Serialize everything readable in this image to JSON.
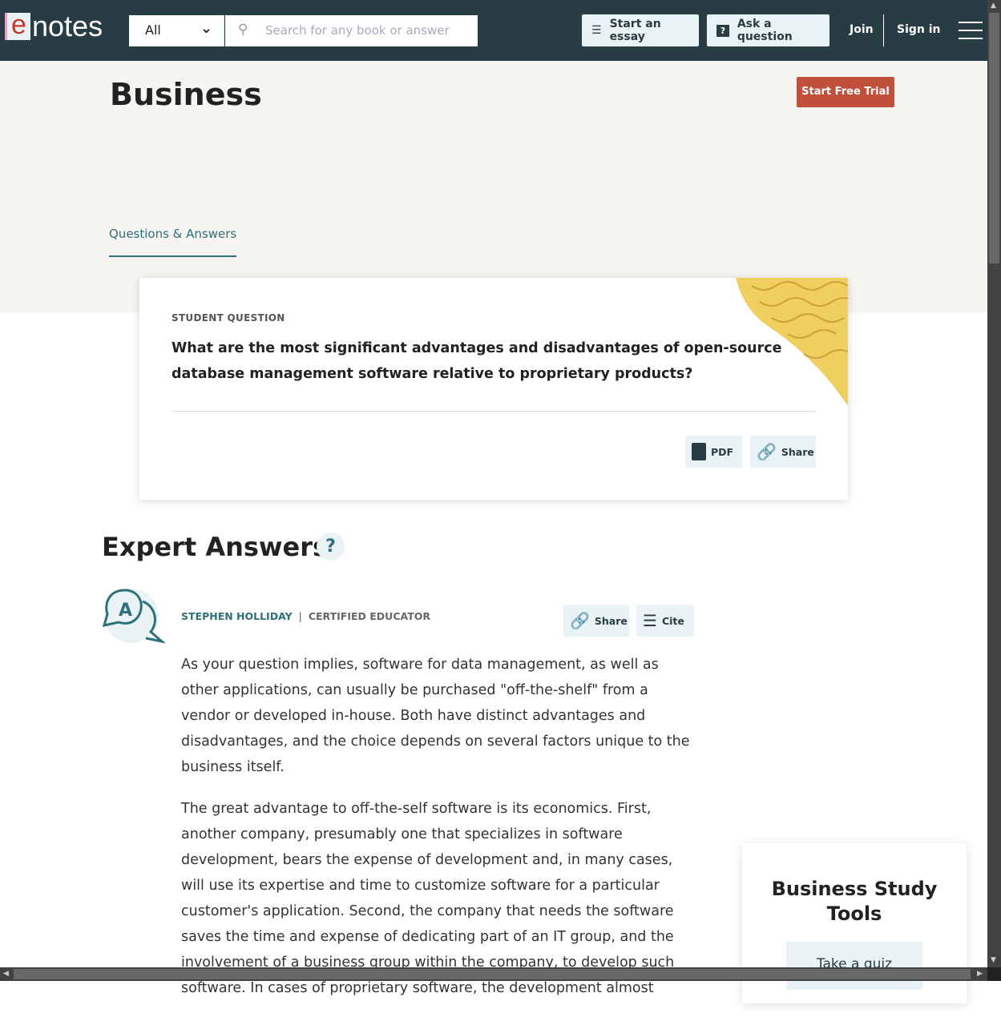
{
  "header": {
    "logo_e": "e",
    "logo_rest": "notes",
    "category": "All",
    "search_placeholder": "Search for any book or answer",
    "start_essay": "Start an essay",
    "ask_question": "Ask a question",
    "join": "Join",
    "sign_in": "Sign in"
  },
  "page": {
    "title": "Business",
    "trial": "Start Free Trial",
    "tab": "Questions & Answers"
  },
  "question": {
    "label": "STUDENT QUESTION",
    "text": "What are the most significant  advantages and disadvantages of open-source database management software relative to proprietary products?",
    "pdf": "PDF",
    "share": "Share"
  },
  "answers": {
    "heading": "Expert Answers",
    "help": "?",
    "author": "STEPHEN HOLLIDAY",
    "separator": "|",
    "role": "CERTIFIED EDUCATOR",
    "share": "Share",
    "cite": "Cite",
    "paragraphs": [
      "As your question implies, software for data management, as well as other applications, can usually be purchased \"off-the-shelf\" from a vendor or developed in-house.  Both have distinct advantages and disadvantages, and the choice depends on several factors unique to the business itself.",
      "The great advantage to off-the-self software is its economics.  First, another company, presumably one that specializes in software development, bears the expense of development and, in many cases, will use its expertise and time to customize software for a particular customer's application.  Second, the company that needs the software saves the time and expense of dedicating part of an IT group, and the involvement of a business group within the company, to develop such software.  In cases of proprietary software, the development almost"
    ]
  },
  "sidebar": {
    "title": "Business Study Tools",
    "quiz": "Take a quiz"
  },
  "colors": {
    "header": "#283c43",
    "accent": "#2d6f7a",
    "trial": "#c0503c"
  }
}
